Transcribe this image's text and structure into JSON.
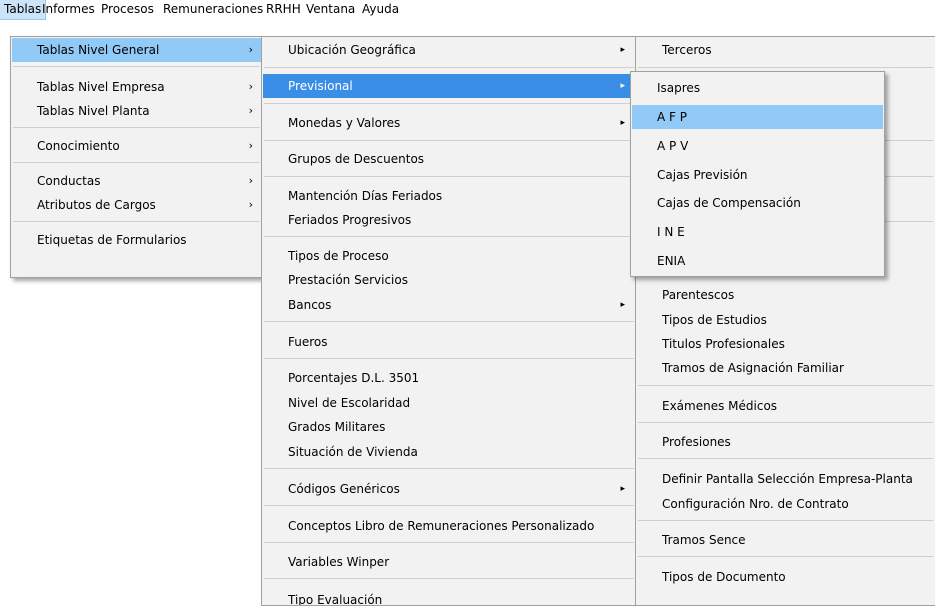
{
  "menubar": {
    "items": [
      "Tablas",
      "Informes",
      "Procesos",
      "Remuneraciones",
      "RRHH",
      "Ventana",
      "Ayuda"
    ]
  },
  "menu1": {
    "items": [
      "Tablas Nivel General",
      "Tablas Nivel Empresa",
      "Tablas Nivel Planta",
      "Conocimiento",
      "Conductas",
      "Atributos de Cargos",
      "Etiquetas de Formularios"
    ],
    "arrow": "›"
  },
  "menu2": {
    "items": [
      "Ubicación Geográfica",
      "Previsional",
      "Monedas y Valores",
      "Grupos de Descuentos",
      "Mantención Días Feriados",
      "Feriados Progresivos",
      "Tipos de Proceso",
      "Prestación Servicios",
      "Bancos",
      "Fueros",
      "Porcentajes D.L. 3501",
      "Nivel de Escolaridad",
      "Grados Militares",
      "Situación de Vivienda",
      "Códigos Genéricos",
      "Conceptos Libro de Remuneraciones Personalizado",
      "Variables Winper",
      "Tipo Evaluación"
    ],
    "arrow": "▸"
  },
  "menu3": {
    "items": [
      "Terceros",
      "Parentescos",
      "Tipos de Estudios",
      "Titulos Profesionales",
      "Tramos de Asignación Familiar",
      "Exámenes Médicos",
      "Profesiones",
      "Definir Pantalla Selección Empresa-Planta",
      "Configuración Nro. de Contrato",
      "Tramos Sence",
      "Tipos de Documento"
    ]
  },
  "menu4": {
    "items": [
      "Isapres",
      "A F P",
      "A P V",
      "Cajas Previsión",
      "Cajas de Compensación",
      "I N E",
      "ENIA"
    ]
  }
}
